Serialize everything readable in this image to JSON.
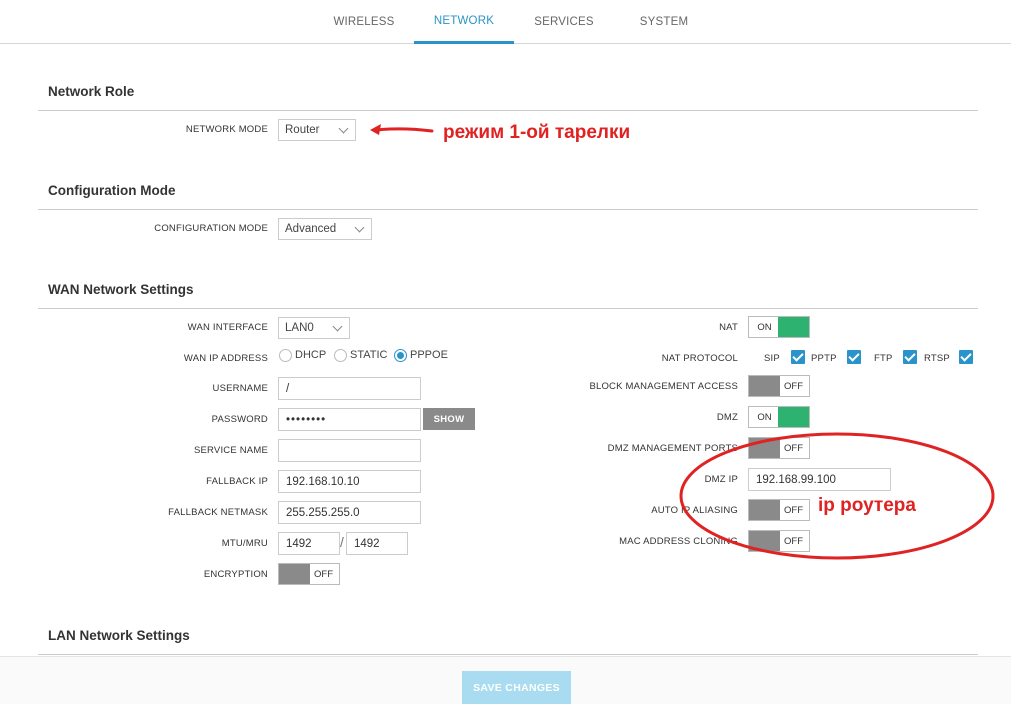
{
  "nav": {
    "tabs": [
      "WIRELESS",
      "NETWORK",
      "SERVICES",
      "SYSTEM"
    ],
    "active": "NETWORK"
  },
  "network_role": {
    "title": "Network Role",
    "network_mode_label": "NETWORK MODE",
    "network_mode_value": "Router"
  },
  "configuration": {
    "title": "Configuration Mode",
    "mode_label": "CONFIGURATION MODE",
    "mode_value": "Advanced"
  },
  "wan": {
    "title": "WAN Network Settings",
    "interface_label": "WAN INTERFACE",
    "interface_value": "LAN0",
    "ip_address_label": "WAN IP ADDRESS",
    "ip_options": [
      "DHCP",
      "STATIC",
      "PPPOE"
    ],
    "ip_selected": "PPPOE",
    "username_label": "USERNAME",
    "username_value": "/",
    "password_label": "PASSWORD",
    "password_value": "••••••••",
    "show_button": "SHOW",
    "service_name_label": "SERVICE NAME",
    "service_name_value": "",
    "fallback_ip_label": "FALLBACK IP",
    "fallback_ip_value": "192.168.10.10",
    "fallback_netmask_label": "FALLBACK NETMASK",
    "fallback_netmask_value": "255.255.255.0",
    "mtu_label": "MTU/MRU",
    "mtu_value": "1492",
    "mtu_separator": "/",
    "mru_value": "1492",
    "encryption_label": "ENCRYPTION",
    "encryption_state": "OFF",
    "nat_label": "NAT",
    "nat_state": "ON",
    "nat_protocol_label": "NAT PROTOCOL",
    "nat_protocols": [
      "SIP",
      "PPTP",
      "FTP",
      "RTSP"
    ],
    "block_mgmt_label": "BLOCK MANAGEMENT ACCESS",
    "block_mgmt_state": "OFF",
    "dmz_label": "DMZ",
    "dmz_state": "ON",
    "dmz_mgmt_ports_label": "DMZ MANAGEMENT PORTS",
    "dmz_mgmt_ports_state": "OFF",
    "dmz_ip_label": "DMZ IP",
    "dmz_ip_value": "192.168.99.100",
    "auto_ip_aliasing_label": "AUTO IP ALIASING",
    "auto_ip_aliasing_state": "OFF",
    "mac_cloning_label": "MAC ADDRESS CLONING",
    "mac_cloning_state": "OFF"
  },
  "lan": {
    "title": "LAN Network Settings"
  },
  "footer": {
    "save_button": "SAVE CHANGES"
  },
  "annotations": {
    "mode_note": "режим 1-ой тарелки",
    "router_ip_note": "ip роутера"
  },
  "colors": {
    "accent": "#2a93c9",
    "toggle_on": "#2db36f",
    "annotation": "#e02222"
  }
}
